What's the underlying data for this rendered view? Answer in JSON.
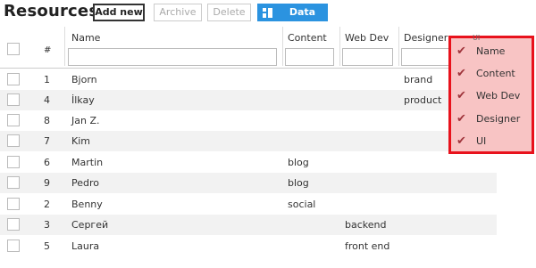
{
  "toolbar": {
    "title": "Resources",
    "add_new": "Add new",
    "archive": "Archive",
    "delete": "Delete",
    "data_fields": "Data Fields",
    "data_fields_icon": "columns-icon",
    "accent": "#2b93e0"
  },
  "table": {
    "headers": {
      "num": "#",
      "name": "Name",
      "content": "Content",
      "webdev": "Web Dev",
      "designer": "Designer"
    },
    "rows": [
      {
        "num": "1",
        "name": "Bjorn",
        "content": "",
        "webdev": "",
        "designer": "brand"
      },
      {
        "num": "4",
        "name": "İlkay",
        "content": "",
        "webdev": "",
        "designer": "product"
      },
      {
        "num": "8",
        "name": "Jan Z.",
        "content": "",
        "webdev": "",
        "designer": ""
      },
      {
        "num": "7",
        "name": "Kim",
        "content": "",
        "webdev": "",
        "designer": ""
      },
      {
        "num": "6",
        "name": "Martin",
        "content": "blog",
        "webdev": "",
        "designer": ""
      },
      {
        "num": "9",
        "name": "Pedro",
        "content": "blog",
        "webdev": "",
        "designer": ""
      },
      {
        "num": "2",
        "name": "Benny",
        "content": "social",
        "webdev": "",
        "designer": ""
      },
      {
        "num": "3",
        "name": "Сергей",
        "content": "",
        "webdev": "backend",
        "designer": ""
      },
      {
        "num": "5",
        "name": "Laura",
        "content": "",
        "webdev": "front end",
        "designer": ""
      }
    ]
  },
  "fields_menu": {
    "peek_header": "UI",
    "items": [
      {
        "label": "Name",
        "checked": true
      },
      {
        "label": "Content",
        "checked": true
      },
      {
        "label": "Web Dev",
        "checked": true
      },
      {
        "label": "Designer",
        "checked": true
      },
      {
        "label": "UI",
        "checked": true
      }
    ],
    "check_glyph": "✔",
    "highlight_color": "#e8121c"
  }
}
